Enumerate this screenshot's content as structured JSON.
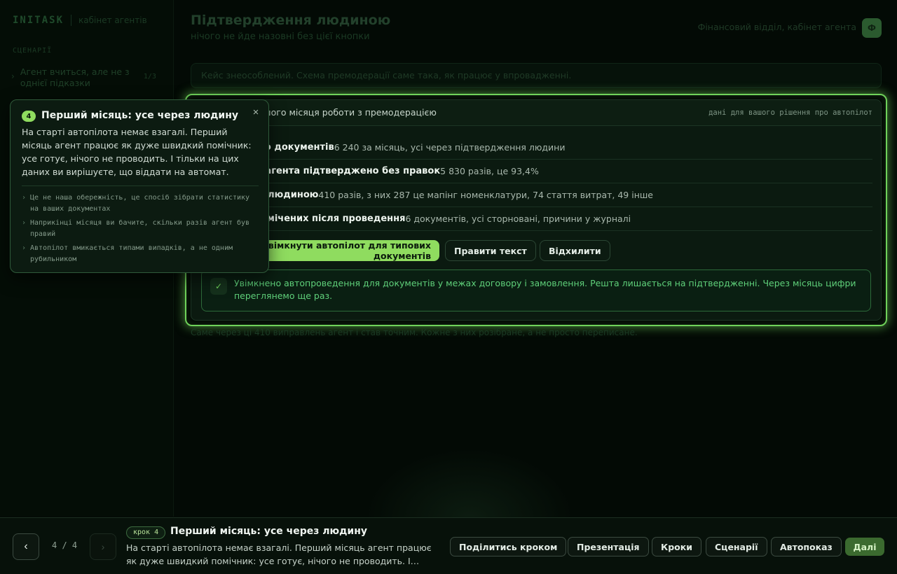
{
  "brand": {
    "logo": "INITASK",
    "subtitle": "кабінет агентів"
  },
  "sidebar": {
    "section_label": "СЦЕНАРІЇ",
    "items": [
      {
        "label": "Агент вчиться, але не з однієї підказки",
        "count": "1/3"
      }
    ]
  },
  "header": {
    "title": "Підтвердження людиною",
    "subtitle": "нічого не йде назовні без цієї кнопки",
    "context": "Фінансовий відділ, кабінет агента",
    "avatar": "Ф"
  },
  "banner": "Кейс знеособлений. Схема премодерації саме така, як працює у впровадженні.",
  "card": {
    "title": "Підсумок першого місяця роботи з премодерацією",
    "meta": "дані для вашого рішення про автопілот",
    "stats": [
      {
        "label": "Опрацьовано документів",
        "value": "6 240 за місяць, усі через підтвердження людини"
      },
      {
        "label": "Пропозицій агента підтверджено без правок",
        "value": "5 830 разів, це 93,4%"
      },
      {
        "label": "Виправлено людиною",
        "value": "410 разів, з них 287 це мапінг номенклатури, 74 стаття витрат, 49 інше"
      },
      {
        "label": "Помилок, помічених після проведення",
        "value": "6 документів, усі сторновані, причини у журналі"
      }
    ],
    "actions": {
      "primary": "Увімкнути автопілот для типових документів",
      "edit": "Правити текст",
      "reject": "Відхилити"
    },
    "success": {
      "icon": "check-icon",
      "message": "Увімкнено автопроведення для документів у межах договору і замовлення. Решта лишається на підтвердженні. Через місяць цифри переглянемо ще раз."
    }
  },
  "footnote": "Саме через ці 410 виправлень агент і став точним. Кожне з них розібране, а не просто переписане.",
  "tooltip": {
    "step": "4",
    "title": "Перший місяць: усе через людину",
    "body": "На старті автопілота немає взагалі. Перший місяць агент працює як дуже швидкий помічник: усе готує, нічого не проводить. І тільки на цих даних ви вирішуєте, що віддати на автомат.",
    "close": "×",
    "bullet": "›",
    "points": [
      "Це не наша обережність, це спосіб зібрати статистику на ваших документах",
      "Наприкінці місяця ви бачите, скільки разів агент був правий",
      "Автопілот вмикається типами випадків, а не одним рубильником"
    ]
  },
  "bottombar": {
    "prev": "‹",
    "next": "›",
    "counter": "4 / 4",
    "step_badge": "крок 4",
    "step_title": "Перший місяць: усе через людину",
    "step_desc": "На старті автопілота немає взагалі. Перший місяць агент працює як дуже швидкий помічник: усе готує, нічого не проводить. І…",
    "buttons": {
      "share": "Поділитись кроком",
      "presentation": "Презентація",
      "steps": "Кроки",
      "scenarios": "Сценарії",
      "autoplay": "Автопоказ",
      "next": "Далі"
    }
  },
  "colors": {
    "accent": "#8fdc5f",
    "highlight": "#6fd25a",
    "success_text": "#5fd07a",
    "background": "#030a05"
  }
}
